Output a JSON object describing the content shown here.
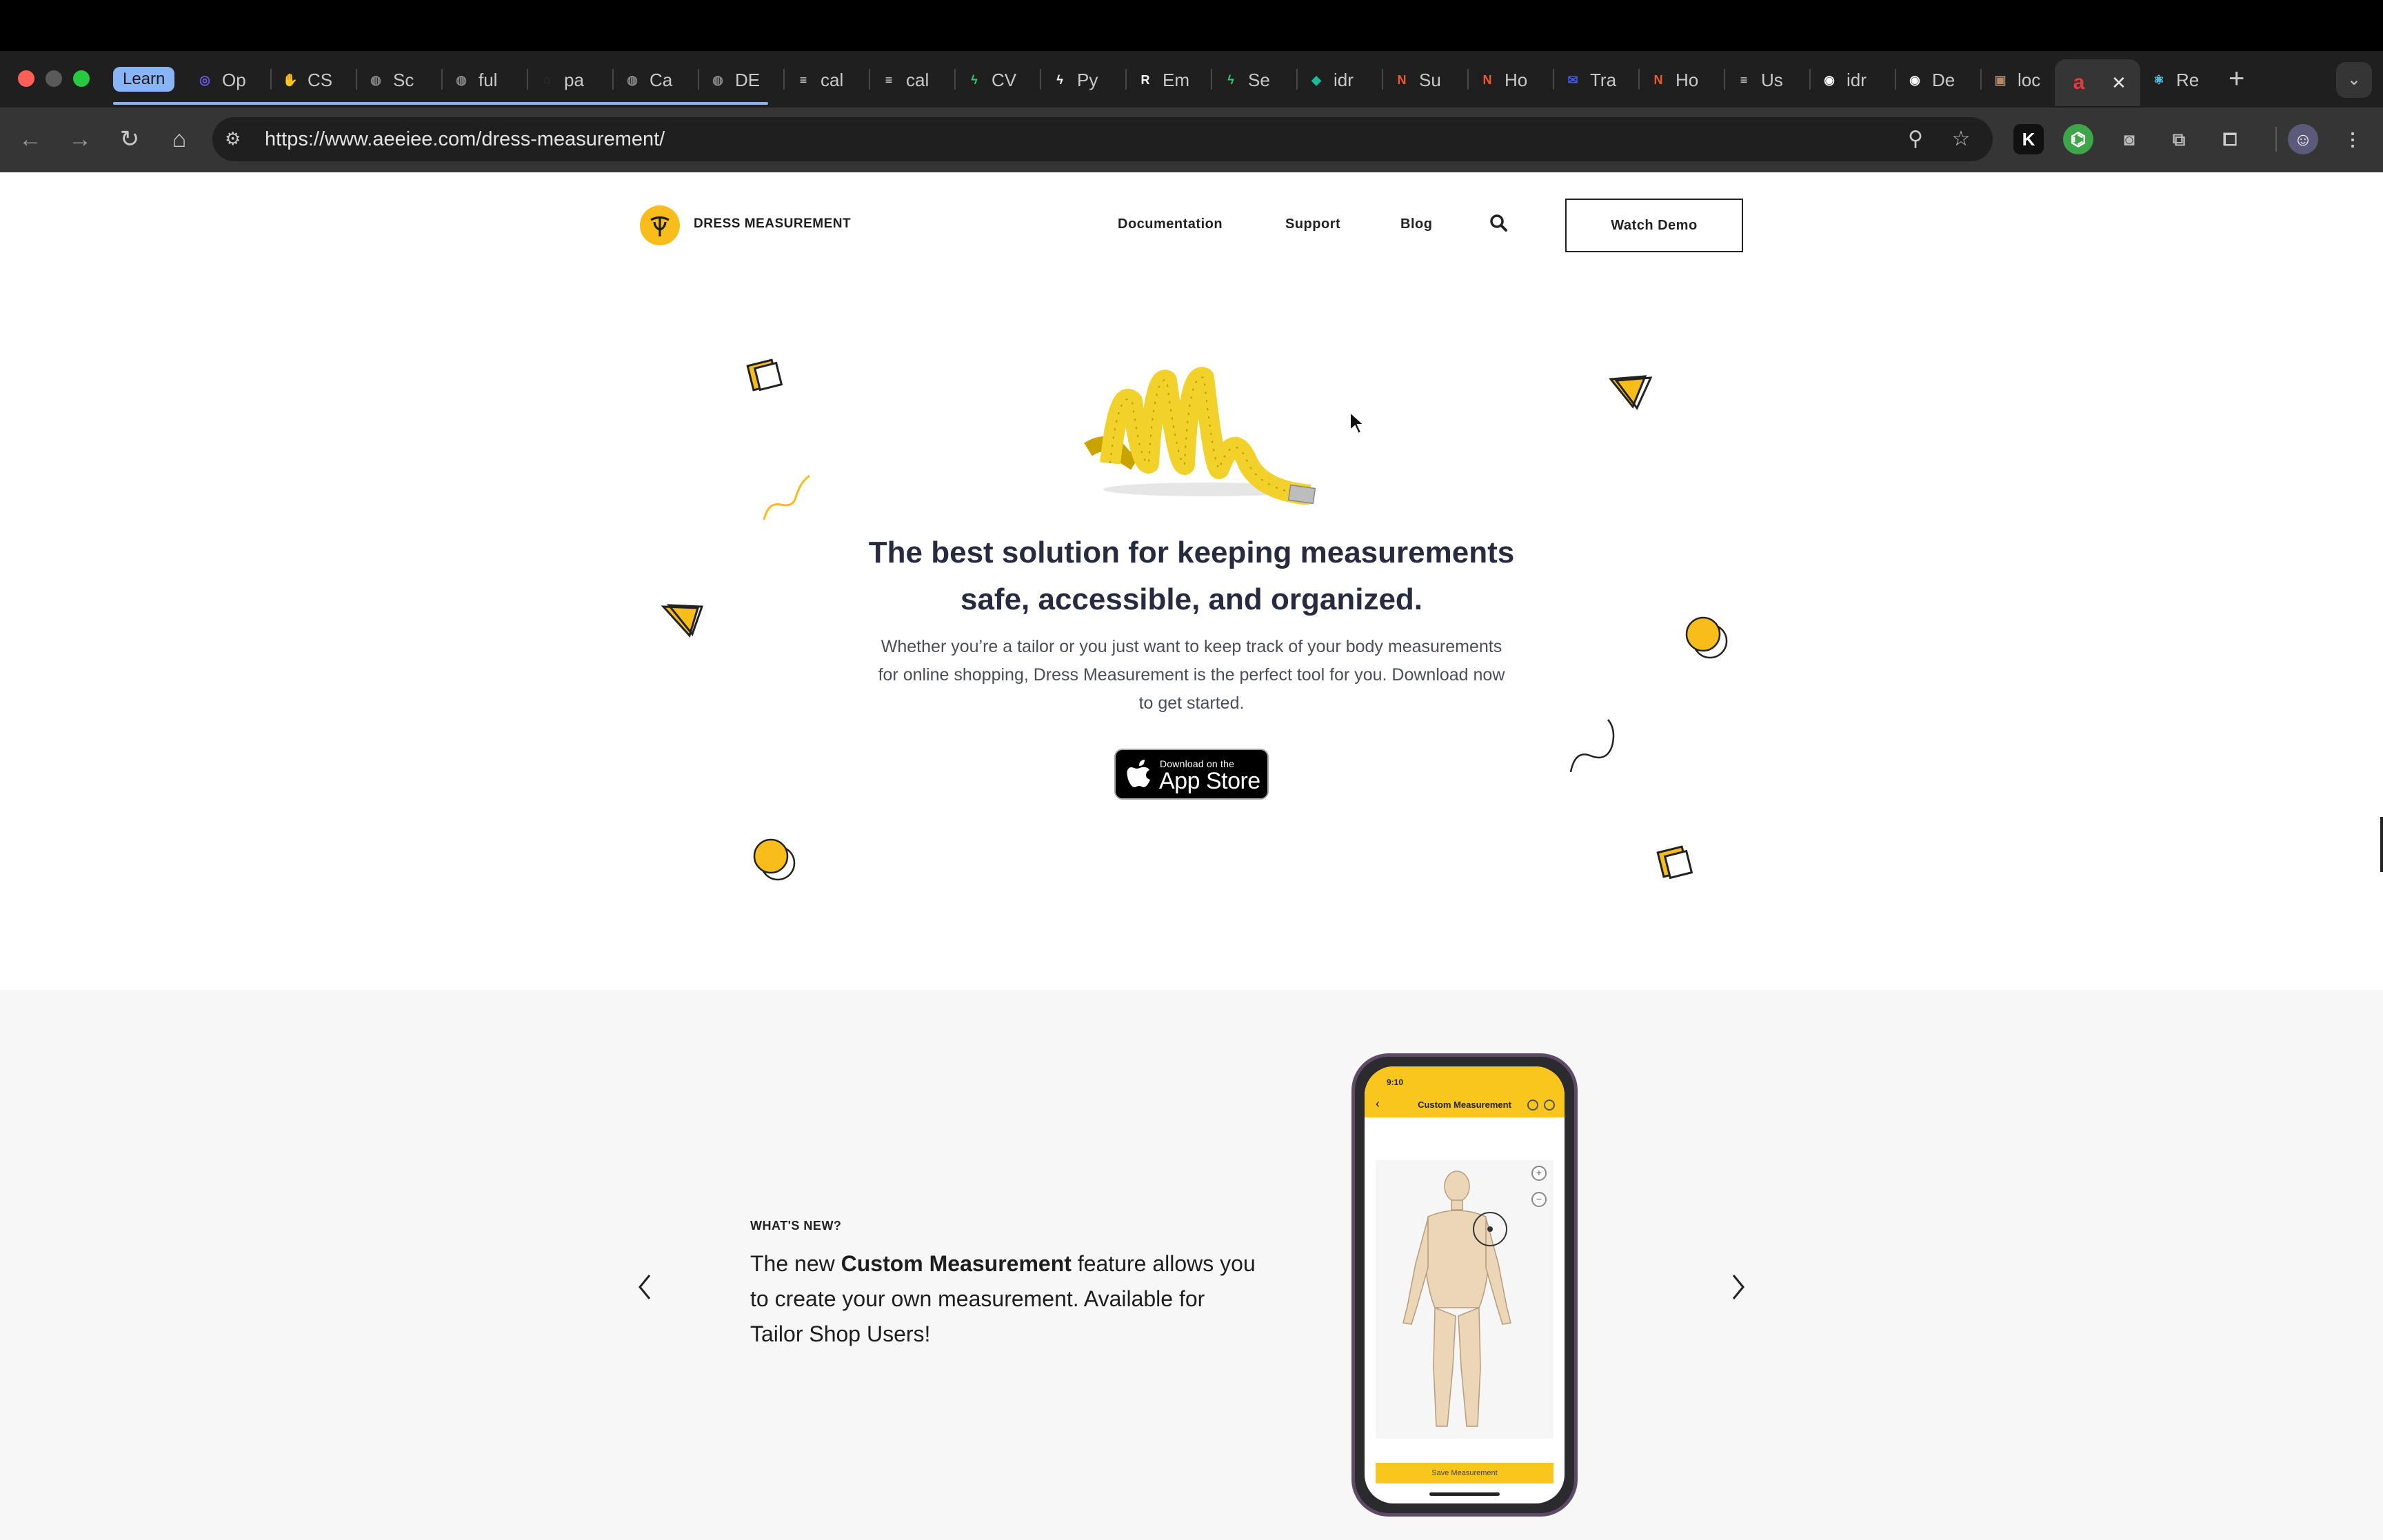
{
  "browser": {
    "tab_group_label": "Learn",
    "tabs": [
      {
        "label": "Op",
        "icon": "openai-icon",
        "color": "#6b5cf6"
      },
      {
        "label": "CS",
        "icon": "hand-icon",
        "color": "#f4b400"
      },
      {
        "label": "Sc",
        "icon": "globe-icon",
        "color": "#8a8a8a"
      },
      {
        "label": "ful",
        "icon": "globe-icon",
        "color": "#8a8a8a"
      },
      {
        "label": "pa",
        "icon": "loading-icon",
        "color": "#444444"
      },
      {
        "label": "Ca",
        "icon": "globe-icon",
        "color": "#8a8a8a"
      },
      {
        "label": "DE",
        "icon": "globe-icon",
        "color": "#8a8a8a"
      },
      {
        "label": "cal",
        "icon": "disc-icon",
        "color": "#dddddd"
      },
      {
        "label": "cal",
        "icon": "disc-icon",
        "color": "#dddddd"
      },
      {
        "label": "CV",
        "icon": "bolt-circle-icon",
        "color": "#2ecc71"
      },
      {
        "label": "Py",
        "icon": "bolt-icon",
        "color": "#ffffff"
      },
      {
        "label": "Em",
        "icon": "r-icon",
        "color": "#ffffff"
      },
      {
        "label": "Se",
        "icon": "bolt-icon",
        "color": "#2ecc71"
      },
      {
        "label": "idr",
        "icon": "diamond-icon",
        "color": "#1abc9c"
      },
      {
        "label": "Su",
        "icon": "n-icon",
        "color": "#f05a28"
      },
      {
        "label": "Ho",
        "icon": "n-icon",
        "color": "#f05a28"
      },
      {
        "label": "Tra",
        "icon": "mail-icon",
        "color": "#3b5bfd"
      },
      {
        "label": "Ho",
        "icon": "n-icon",
        "color": "#f05a28"
      },
      {
        "label": "Us",
        "icon": "disc-icon",
        "color": "#dddddd"
      },
      {
        "label": "idr",
        "icon": "github-icon",
        "color": "#ffffff"
      },
      {
        "label": "De",
        "icon": "github-icon",
        "color": "#ffffff"
      },
      {
        "label": "loc",
        "icon": "person-icon",
        "color": "#b08a6a"
      }
    ],
    "active_tab": {
      "label": "",
      "icon": "a-icon",
      "color": "#e8383d"
    },
    "after_active": {
      "label": "Re",
      "icon": "react-icon",
      "color": "#61dafb"
    },
    "url": "https://www.aeeiee.com/dress-measurement/"
  },
  "site": {
    "brand": "DRESS MEASUREMENT",
    "nav": [
      "Documentation",
      "Support",
      "Blog"
    ],
    "cta": "Watch Demo"
  },
  "hero": {
    "title": "The best solution for keeping measurements safe, accessible, and organized.",
    "subtitle": "Whether you’re a tailor or you just want to keep track of your body measurements for online shopping, Dress Measurement is the perfect tool for you. Download now to get started.",
    "appstore_small": "Download on the",
    "appstore_big": "App Store"
  },
  "whats_new": {
    "label": "WHAT'S NEW?",
    "text_before": "The new ",
    "text_bold": "Custom Measurement",
    "text_after": " feature allows you to create your own measurement. Available for Tailor Shop Users!",
    "phone": {
      "time": "9:10",
      "title": "Custom Measurement",
      "save_label": "Save Measurement"
    }
  },
  "colors": {
    "brand_yellow": "#f9bd1b",
    "text_dark": "#272b3f"
  }
}
